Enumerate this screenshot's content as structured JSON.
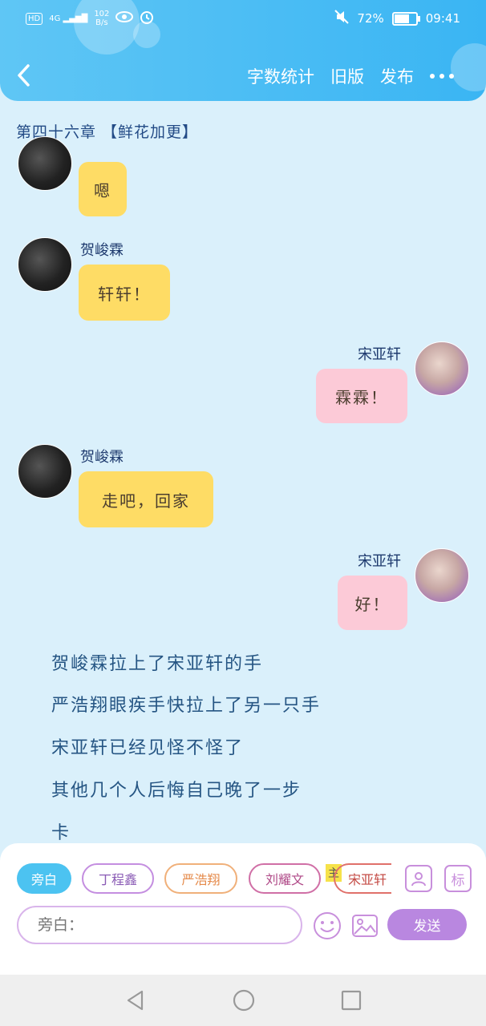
{
  "status": {
    "network": "4G",
    "speed_top": "102",
    "speed_bottom": "B/s",
    "battery": "72%",
    "time": "09:41"
  },
  "header": {
    "actions": [
      "字数统计",
      "旧版",
      "发布"
    ]
  },
  "chapter": "第四十六章 【鲜花加更】",
  "messages": [
    {
      "name": "",
      "text": "嗯"
    },
    {
      "name": "贺峻霖",
      "text": "轩轩！"
    },
    {
      "name": "宋亚轩",
      "text": "霖霖！"
    },
    {
      "name": "贺峻霖",
      "text": "走吧，回家"
    },
    {
      "name": "宋亚轩",
      "text": "好！"
    }
  ],
  "narration": [
    "贺峻霖拉上了宋亚轩的手",
    "严浩翔眼疾手快拉上了另一只手",
    "宋亚轩已经见怪不怪了",
    "其他几个人后悔自己晚了一步",
    "卡"
  ],
  "characters": [
    "旁白",
    "丁程鑫",
    "严浩翔",
    "刘耀文",
    "宋亚轩"
  ],
  "main_tag": "主",
  "tag_label": "标",
  "input": {
    "placeholder": "旁白："
  },
  "send_label": "发送",
  "colors": {
    "header": "#3ab5f3",
    "left_bubble": "#fedc65",
    "right_bubble": "#fccad7",
    "send": "#b987e0"
  }
}
